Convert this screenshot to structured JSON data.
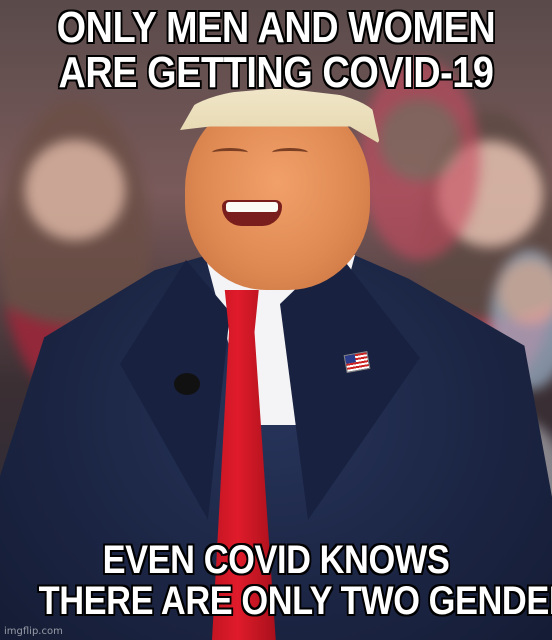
{
  "meme": {
    "top_text": [
      "ONLY MEN AND WOMEN",
      "ARE GETTING COVID-19"
    ],
    "bottom_text": [
      "EVEN COVID KNOWS",
      "THERE ARE ONLY TWO GENDERS"
    ],
    "watermark": "imgflip.com"
  },
  "colors": {
    "caption_fill": "#ffffff",
    "caption_stroke": "#000000",
    "suit": "#1c2645",
    "tie": "#e01b2b"
  },
  "icons": [
    "flag-pin-icon",
    "microphone-icon"
  ]
}
